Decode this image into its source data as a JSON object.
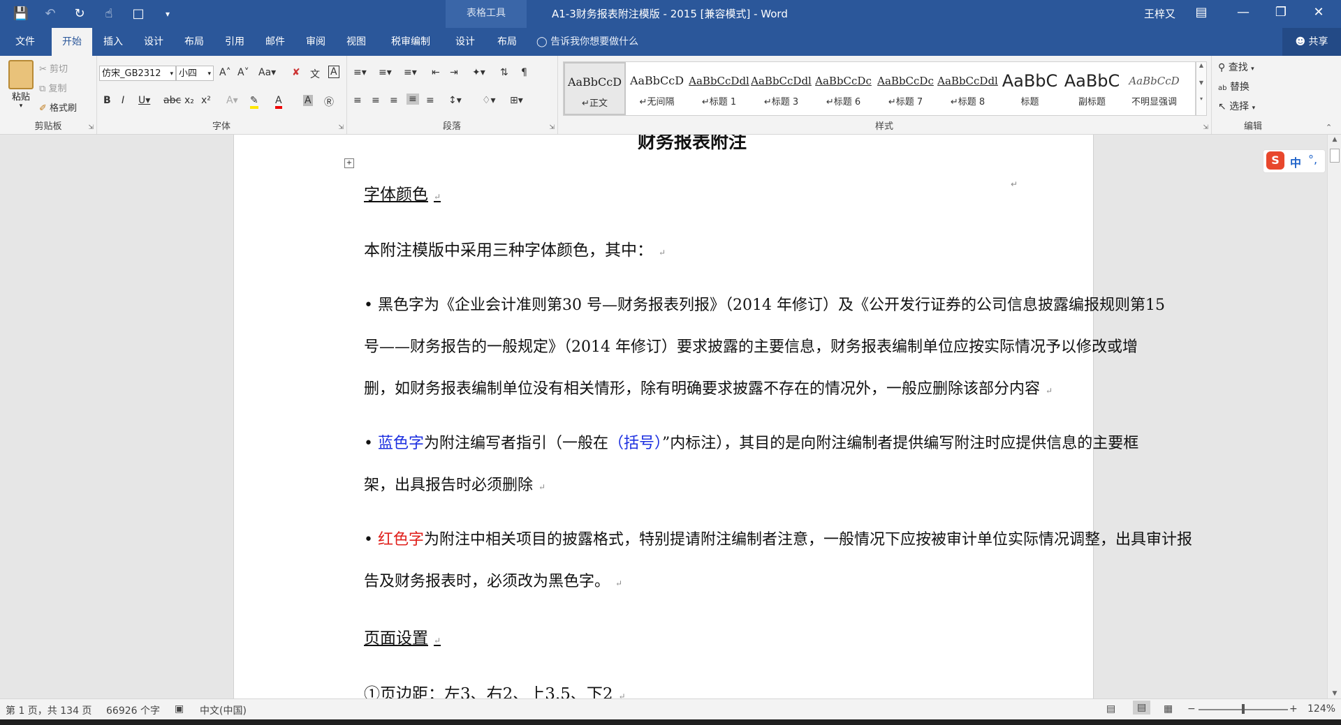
{
  "window": {
    "context_tab": "表格工具",
    "title": "A1-3财务报表附注模版 - 2015 [兼容模式]  -  Word",
    "user": "王梓又"
  },
  "tabs": [
    "文件",
    "开始",
    "插入",
    "设计",
    "布局",
    "引用",
    "邮件",
    "审阅",
    "视图",
    "税审编制",
    "设计",
    "布局"
  ],
  "active_tab": "开始",
  "tellme": "告诉我你想要做什么",
  "share": "共享",
  "clipboard": {
    "paste": "粘贴",
    "cut": "剪切",
    "copy": "复制",
    "format_painter": "格式刷",
    "label": "剪贴板"
  },
  "font": {
    "name": "仿宋_GB2312",
    "size": "小四",
    "label": "字体"
  },
  "paragraph": {
    "label": "段落"
  },
  "styles": {
    "label": "样式",
    "items": [
      {
        "preview": "AaBbCcD",
        "name": "↵正文"
      },
      {
        "preview": "AaBbCcD",
        "name": "↵无间隔"
      },
      {
        "preview": "AaBbCcDdl",
        "name": "↵标题 1"
      },
      {
        "preview": "AaBbCcDdl",
        "name": "↵标题 3"
      },
      {
        "preview": "AaBbCcDc",
        "name": "↵标题 6"
      },
      {
        "preview": "AaBbCcDc",
        "name": "↵标题 7"
      },
      {
        "preview": "AaBbCcDdl",
        "name": "↵标题 8"
      },
      {
        "preview": "AaBbC",
        "name": "标题"
      },
      {
        "preview": "AaBbC",
        "name": "副标题"
      },
      {
        "preview": "AaBbCcD",
        "name": "不明显强调"
      }
    ]
  },
  "editing": {
    "find": "查找",
    "replace": "替换",
    "select": "选择",
    "label": "编辑"
  },
  "document": {
    "top_cut": "财务报表附注",
    "heading1": "字体颜色",
    "intro": "本附注模版中采用三种字体颜色，其中：",
    "b1_l1": "• 黑色字为《企业会计准则第30 号—财务报表列报》（2014 年修订）及《公开发行证券的公司信息披露编报规则第15",
    "b1_l2": "号——财务报告的一般规定》（2014 年修订）要求披露的主要信息，财务报表编制单位应按实际情况予以修改或增",
    "b1_l3": "删，如财务报表编制单位没有相关情形，除有明确要求披露不存在的情况外，一般应删除该部分内容",
    "b2_bullet": "• ",
    "b2_colored": "蓝色字",
    "b2_mid": "为附注编写者指引（一般在",
    "b2_paren": "（括号）",
    "b2_rest": "”内标注），其目的是向附注编制者提供编写附注时应提供信息的主要框",
    "b2_l2": "架，出具报告时必须删除",
    "b3_bullet": "• ",
    "b3_colored": "红色字",
    "b3_rest": "为附注中相关项目的披露格式，特别提请附注编制者注意，一般情况下应按被审计单位实际情况调整，出具审计报",
    "b3_l2": "告及财务报表时，必须改为黑色字。",
    "heading2": "页面设置",
    "margins": "①页边距：左3、右2、上3.5、下2"
  },
  "ime": {
    "mode": "中"
  },
  "status": {
    "page": "第 1 页，共 134 页",
    "words": "66926 个字",
    "lang": "中文(中国)",
    "zoom": "124%"
  }
}
